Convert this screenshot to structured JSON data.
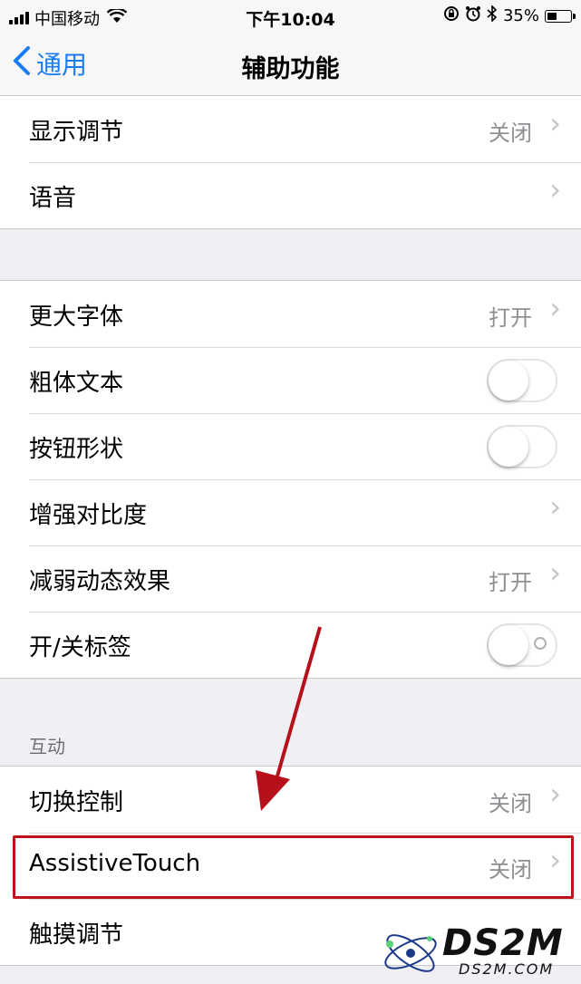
{
  "status_bar": {
    "carrier": "中国移动",
    "time": "下午10:04",
    "battery": "35%",
    "battery_level": 0.35
  },
  "nav": {
    "back_label": "通用",
    "title": "辅助功能"
  },
  "group1": [
    {
      "label": "显示调节",
      "value": "关闭"
    },
    {
      "label": "语音",
      "value": ""
    }
  ],
  "group2": [
    {
      "label": "更大字体",
      "value": "打开"
    },
    {
      "label": "粗体文本",
      "toggle": false
    },
    {
      "label": "按钮形状",
      "toggle": false
    },
    {
      "label": "增强对比度",
      "value": ""
    },
    {
      "label": "减弱动态效果",
      "value": "打开"
    },
    {
      "label": "开/关标签",
      "toggle": false
    }
  ],
  "interaction": {
    "header": "互动",
    "rows": [
      {
        "label": "切换控制",
        "value": "关闭"
      },
      {
        "label": "AssistiveTouch",
        "value": "关闭"
      },
      {
        "label": "触摸调节",
        "value": ""
      }
    ]
  },
  "watermark": {
    "text": "DS2M",
    "sub": "DS2M.COM"
  },
  "colors": {
    "accent": "#1a7cf5",
    "highlight": "#c0101a"
  }
}
